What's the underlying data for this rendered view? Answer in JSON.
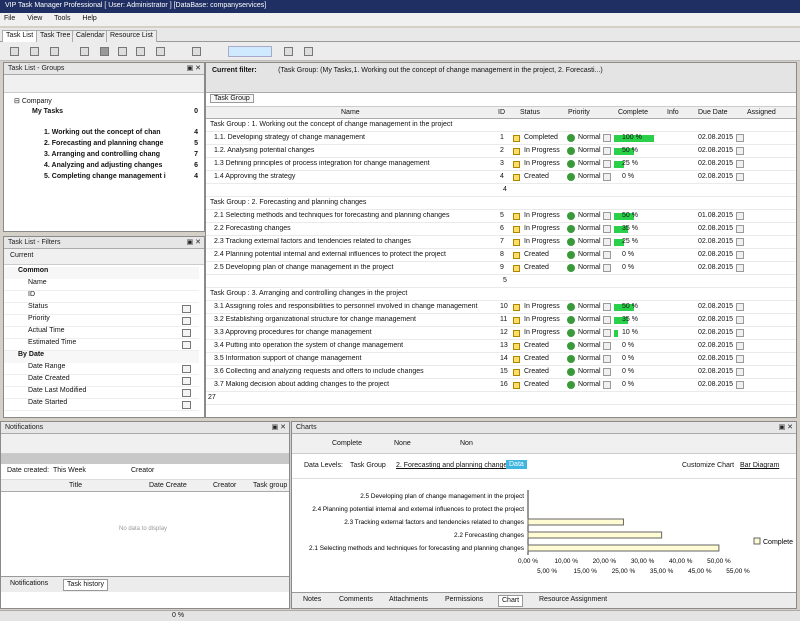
{
  "window": {
    "title": "VIP Task Manager Professional [ User: Administrator ] [DataBase: companyservices]"
  },
  "menu": [
    "File",
    "View",
    "Tools",
    "Help"
  ],
  "tabs": [
    "Task List",
    "Task Tree",
    "Calendar",
    "Resource List"
  ],
  "groups_panel": {
    "title": "Task List - Groups",
    "root": "Company",
    "my_tasks": {
      "label": "My Tasks",
      "count": "0"
    },
    "items": [
      {
        "label": "1. Working out the concept of chan",
        "count": "4"
      },
      {
        "label": "2. Forecasting and planning change",
        "count": "5"
      },
      {
        "label": "3. Arranging and controlling chang",
        "count": "7"
      },
      {
        "label": "4. Analyzing and adjusting changes",
        "count": "6"
      },
      {
        "label": "5. Completing change management i",
        "count": "4"
      }
    ]
  },
  "filters_panel": {
    "title": "Task List - Filters",
    "current": "Current",
    "common_header": "Common",
    "common": [
      "Name",
      "ID",
      "Status",
      "Priority",
      "Actual Time",
      "Estimated Time"
    ],
    "date_header": "By Date",
    "dates": [
      "Date Range",
      "Date Created",
      "Date Last Modified",
      "Date Started"
    ]
  },
  "main": {
    "current_filter_label": "Current filter:",
    "current_filter_value": "(Task Group: (My Tasks,1. Working out the concept of change management in the project, 2. Forecasti...)",
    "group_button": "Task Group",
    "columns": [
      "Name",
      "ID",
      "Status",
      "Priority",
      "Complete",
      "Info",
      "Due Date",
      "Assigned"
    ],
    "groups": [
      {
        "header": "Task Group : 1. Working out the concept of change management in the project",
        "total": "4",
        "rows": [
          {
            "name": "1.1. Developing strategy of change management",
            "id": "1",
            "status": "Completed",
            "priority": "Normal",
            "complete": "100 %",
            "pct": 1.0,
            "due": "02.08.2015"
          },
          {
            "name": "1.2. Analysing potential changes",
            "id": "2",
            "status": "In Progress",
            "priority": "Normal",
            "complete": "50 %",
            "pct": 0.5,
            "due": "02.08.2015"
          },
          {
            "name": "1.3 Defining principles of process integration for change management",
            "id": "3",
            "status": "In Progress",
            "priority": "Normal",
            "complete": "25 %",
            "pct": 0.25,
            "due": "02.08.2015"
          },
          {
            "name": "1.4 Approving the strategy",
            "id": "4",
            "status": "Created",
            "priority": "Normal",
            "complete": "0 %",
            "pct": 0,
            "due": "02.08.2015"
          }
        ]
      },
      {
        "header": "Task Group : 2. Forecasting and planning changes",
        "total": "5",
        "rows": [
          {
            "name": "2.1 Selecting methods and techniques for forecasting and planning changes",
            "id": "5",
            "status": "In Progress",
            "priority": "Normal",
            "complete": "50 %",
            "pct": 0.5,
            "due": "01.08.2015"
          },
          {
            "name": "2.2 Forecasting changes",
            "id": "6",
            "status": "In Progress",
            "priority": "Normal",
            "complete": "35 %",
            "pct": 0.35,
            "due": "02.08.2015"
          },
          {
            "name": "2.3 Tracking external factors and tendencies related to changes",
            "id": "7",
            "status": "In Progress",
            "priority": "Normal",
            "complete": "25 %",
            "pct": 0.25,
            "due": "02.08.2015"
          },
          {
            "name": "2.4 Planning potential internal and external influences to protect the project",
            "id": "8",
            "status": "Created",
            "priority": "Normal",
            "complete": "0 %",
            "pct": 0,
            "due": "02.08.2015"
          },
          {
            "name": "2.5 Developing plan of change management in the project",
            "id": "9",
            "status": "Created",
            "priority": "Normal",
            "complete": "0 %",
            "pct": 0,
            "due": "02.08.2015"
          }
        ]
      },
      {
        "header": "Task Group : 3. Arranging and controlling changes in the project",
        "total": "",
        "rows": [
          {
            "name": "3.1 Assigning roles and responsibilities to personnel involved in change management",
            "id": "10",
            "status": "In Progress",
            "priority": "Normal",
            "complete": "50 %",
            "pct": 0.5,
            "due": "02.08.2015"
          },
          {
            "name": "3.2 Establishing organizational structure for change management",
            "id": "11",
            "status": "In Progress",
            "priority": "Normal",
            "complete": "35 %",
            "pct": 0.35,
            "due": "02.08.2015"
          },
          {
            "name": "3.3 Approving procedures for change management",
            "id": "12",
            "status": "In Progress",
            "priority": "Normal",
            "complete": "10 %",
            "pct": 0.1,
            "due": "02.08.2015"
          },
          {
            "name": "3.4 Putting into operation the system of change management",
            "id": "13",
            "status": "Created",
            "priority": "Normal",
            "complete": "0 %",
            "pct": 0,
            "due": "02.08.2015"
          },
          {
            "name": "3.5 Information support of change management",
            "id": "14",
            "status": "Created",
            "priority": "Normal",
            "complete": "0 %",
            "pct": 0,
            "due": "02.08.2015"
          },
          {
            "name": "3.6 Collecting and analyzing requests and offers to include changes",
            "id": "15",
            "status": "Created",
            "priority": "Normal",
            "complete": "0 %",
            "pct": 0,
            "due": "02.08.2015"
          },
          {
            "name": "3.7 Making decision about adding changes to the project",
            "id": "16",
            "status": "Created",
            "priority": "Normal",
            "complete": "0 %",
            "pct": 0,
            "due": "02.08.2015"
          }
        ]
      }
    ],
    "footer_total": "27"
  },
  "notifications": {
    "title": "Notifications",
    "date_created_label": "Date created:",
    "date_created_value": "This Week",
    "creator_label": "Creator",
    "columns": [
      "Title",
      "Date Create",
      "Creator",
      "Task group"
    ],
    "empty": "No data to display",
    "bottom_tabs": [
      "Notifications",
      "Task history"
    ]
  },
  "charts": {
    "title": "Charts",
    "combo1": "Complete",
    "combo2": "None",
    "combo3": "Non",
    "data_levels_label": "Data Levels:",
    "crumbs": [
      "Task Group",
      "2. Forecasting and planning changes",
      "Data"
    ],
    "customize": "Customize Chart",
    "bar_diagram": "Bar Diagram",
    "legend": "Complete",
    "bottom_tabs": [
      "Notes",
      "Comments",
      "Attachments",
      "Permissions",
      "Chart",
      "Resource Assignment"
    ]
  },
  "status_bar": {
    "value": "0 %"
  },
  "chart_data": {
    "type": "bar",
    "orientation": "horizontal",
    "categories": [
      "2.5 Developing plan of change management in the project",
      "2.4 Planning potential internal and external influences to protect the project",
      "2.3 Tracking external factors and tendencies related to changes",
      "2.2 Forecasting changes",
      "2.1 Selecting methods and techniques for forecasting and planning changes"
    ],
    "values": [
      0,
      0,
      25,
      35,
      50
    ],
    "xlim": [
      0,
      55
    ],
    "ticks_top": [
      "0,00 %",
      "10,00 %",
      "20,00 %",
      "30,00 %",
      "40,00 %",
      "50,00 %"
    ],
    "ticks_bottom": [
      "5,00 %",
      "15,00 %",
      "25,00 %",
      "35,00 %",
      "45,00 %",
      "55,00 %"
    ],
    "legend": "Complete"
  }
}
